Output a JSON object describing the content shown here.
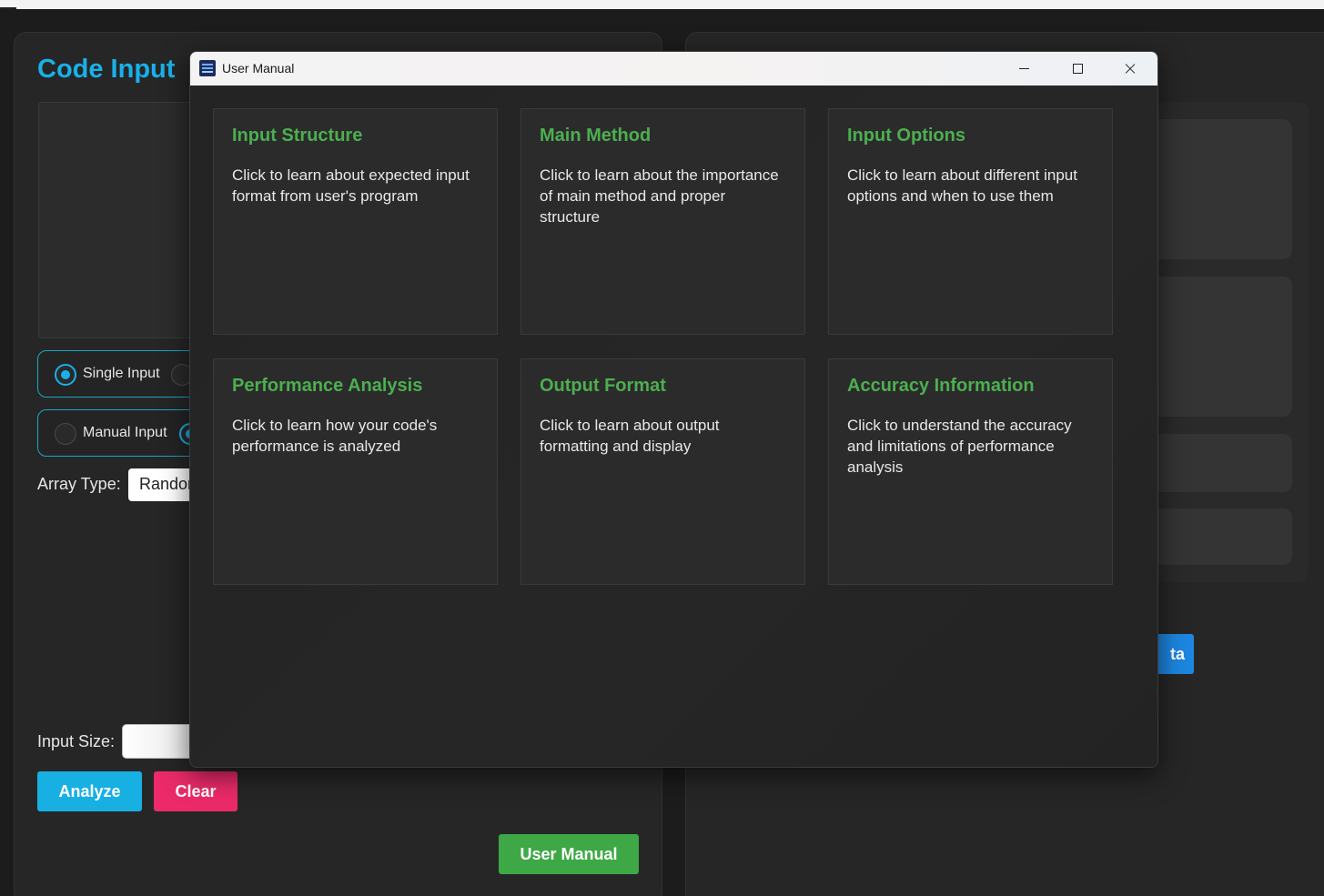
{
  "app": {
    "code_input_title": "Code Input",
    "single_input_label": "Single Input",
    "manual_input_label": "Manual Input",
    "array_type_label": "Array Type:",
    "array_type_value": "Randor",
    "input_size_label": "Input Size:",
    "analyze_label": "Analyze",
    "clear_label": "Clear",
    "user_manual_label": "User Manual",
    "right_button_label": "ta"
  },
  "dialog": {
    "title": "User Manual",
    "cards": [
      {
        "title": "Input Structure",
        "text": "Click to learn about expected input format from user's program"
      },
      {
        "title": "Main Method",
        "text": "Click to learn about the importance of main method and proper structure"
      },
      {
        "title": "Input Options",
        "text": "Click to learn about different input options and when to use them"
      },
      {
        "title": "Performance Analysis",
        "text": "Click to learn how your code's performance is analyzed"
      },
      {
        "title": "Output Format",
        "text": "Click to learn about output formatting and display"
      },
      {
        "title": "Accuracy Information",
        "text": "Click to understand the accuracy and limitations of performance analysis"
      }
    ]
  },
  "colors": {
    "accent_blue": "#1ab0e8",
    "card_title_green": "#4caf50",
    "analyze_button": "#18b0e2",
    "clear_button": "#ec2a6a",
    "manual_button": "#3da845"
  }
}
